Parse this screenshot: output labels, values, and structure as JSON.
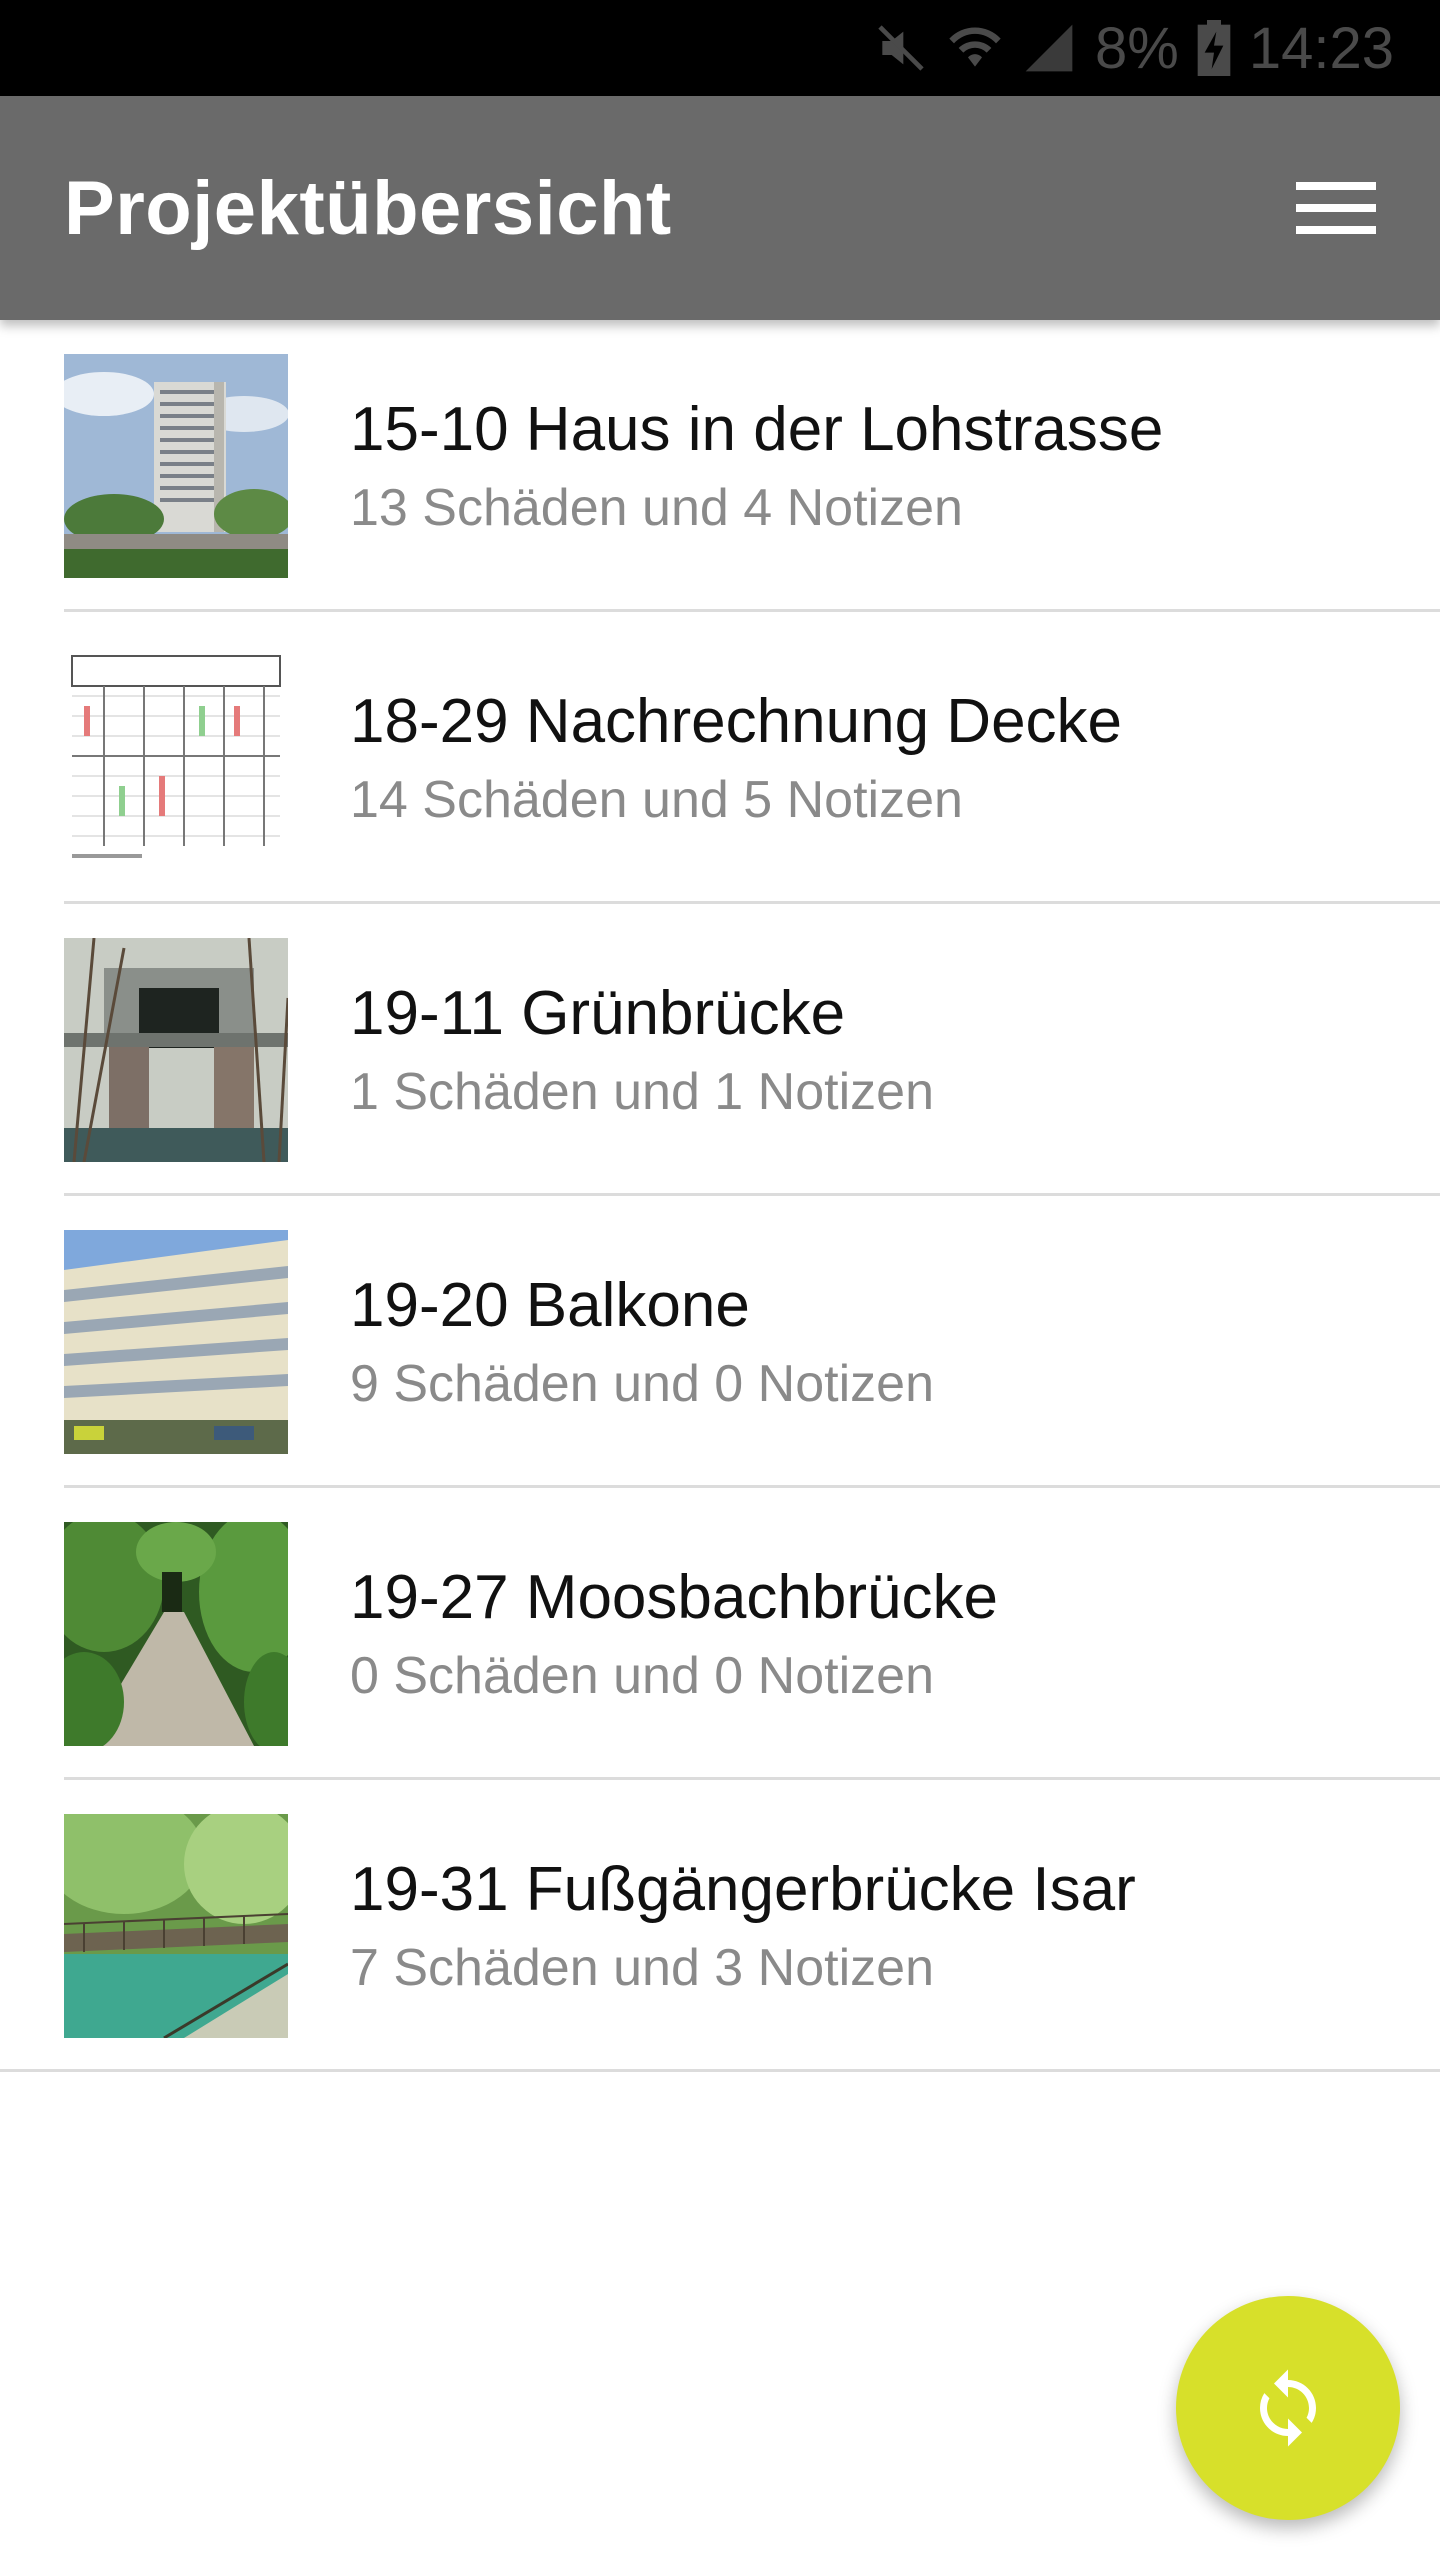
{
  "status_bar": {
    "battery": "8%",
    "time": "14:23",
    "icons": [
      "mute-icon",
      "wifi-icon",
      "signal-icon",
      "battery-charging-icon"
    ]
  },
  "app_bar": {
    "title": "Projektübersicht",
    "menu_icon": "hamburger-menu-icon"
  },
  "projects": [
    {
      "title": "15-10 Haus in der Lohstrasse",
      "subtitle": "13 Schäden und 4 Notizen",
      "thumbnail": "high-rise-building-photo"
    },
    {
      "title": "18-29 Nachrechnung Decke",
      "subtitle": "14 Schäden und 5 Notizen",
      "thumbnail": "floor-plan-drawing"
    },
    {
      "title": "19-11 Grünbrücke",
      "subtitle": "1 Schäden und 1 Notizen",
      "thumbnail": "bridge-underpass-photo"
    },
    {
      "title": "19-20 Balkone",
      "subtitle": "9 Schäden und 0 Notizen",
      "thumbnail": "balcony-building-photo"
    },
    {
      "title": "19-27 Moosbachbrücke",
      "subtitle": "0 Schäden und 0 Notizen",
      "thumbnail": "forest-path-photo"
    },
    {
      "title": "19-31 Fußgängerbrücke Isar",
      "subtitle": "7 Schäden und 3 Notizen",
      "thumbnail": "footbridge-river-photo"
    }
  ],
  "fab": {
    "icon": "sync-icon",
    "color": "#d7e02a"
  },
  "colors": {
    "app_bar": "#6a6a6a",
    "divider": "#dcdcdc",
    "subtitle": "#8a8a8a"
  }
}
